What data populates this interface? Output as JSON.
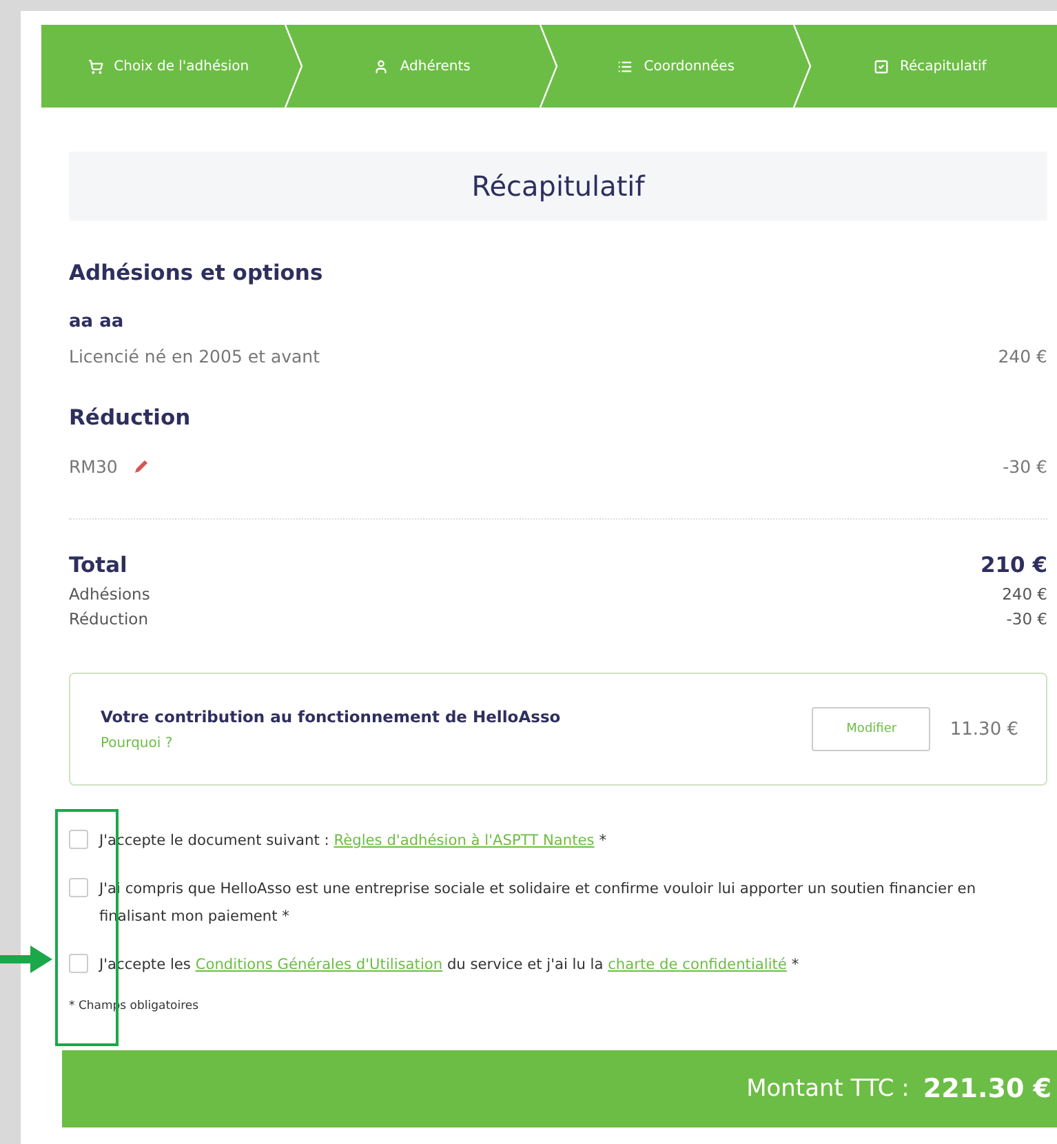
{
  "steps": [
    {
      "label": "Choix de l'adhésion"
    },
    {
      "label": "Adhérents"
    },
    {
      "label": "Coordonnées"
    },
    {
      "label": "Récapitulatif"
    }
  ],
  "title": "Récapitulatif",
  "sections": [
    {
      "heading": "Adhésions et options",
      "lines": [
        {
          "name": "aa aa",
          "label": "Licencié né en 2005 et avant",
          "amount": "240 €",
          "editable": false
        }
      ]
    },
    {
      "heading": "Réduction",
      "lines": [
        {
          "label": "RM30",
          "amount": "-30 €",
          "editable": true
        }
      ]
    }
  ],
  "total": {
    "label": "Total",
    "amount": "210 €",
    "rows": [
      {
        "label": "Adhésions",
        "amount": "240 €"
      },
      {
        "label": "Réduction",
        "amount": "-30 €"
      }
    ]
  },
  "contribution": {
    "title": "Votre contribution au fonctionnement de HelloAsso",
    "link": "Pourquoi ?",
    "button": "Modifier",
    "amount": "11.30 €"
  },
  "agreements": [
    {
      "checked": false,
      "parts": [
        {
          "kind": "text",
          "text": "J'accepte le document suivant : "
        },
        {
          "kind": "link",
          "text": "Règles d'adhésion à l'ASPTT Nantes"
        },
        {
          "kind": "text",
          "text": " *"
        }
      ]
    },
    {
      "checked": false,
      "parts": [
        {
          "kind": "text",
          "text": "J'ai compris que HelloAsso est une entreprise sociale et solidaire et confirme vouloir lui apporter un soutien financier en finalisant mon paiement *"
        }
      ]
    },
    {
      "checked": false,
      "parts": [
        {
          "kind": "text",
          "text": "J'accepte les "
        },
        {
          "kind": "link",
          "text": "Conditions Générales d'Utilisation"
        },
        {
          "kind": "text",
          "text": " du service et j'ai lu la "
        },
        {
          "kind": "link",
          "text": "charte de confidentialité"
        },
        {
          "kind": "text",
          "text": " *"
        }
      ]
    }
  ],
  "required_note": "* Champs obligatoires",
  "footer": {
    "label": "Montant TTC :",
    "amount": "221.30 €"
  }
}
